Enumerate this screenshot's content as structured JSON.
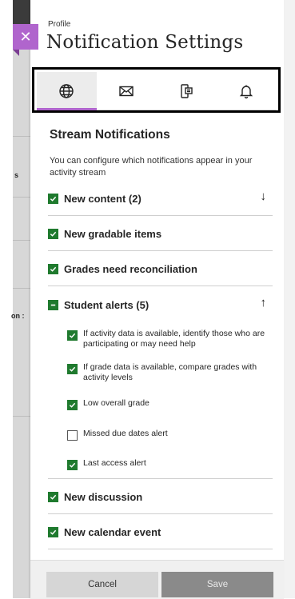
{
  "background_page": {
    "fragments": [
      "s",
      "on :"
    ]
  },
  "header": {
    "breadcrumb": "Profile",
    "title": "Notification Settings",
    "close_icon": "close-icon"
  },
  "tabs": [
    {
      "icon": "globe-icon",
      "active": true
    },
    {
      "icon": "envelope-icon",
      "active": false
    },
    {
      "icon": "mobile-push-icon",
      "active": false
    },
    {
      "icon": "bell-icon",
      "active": false
    }
  ],
  "section": {
    "title": "Stream Notifications",
    "description": "You can configure which notifications appear in your activity stream"
  },
  "options": [
    {
      "label": "New content (2)",
      "state": "checked",
      "expandable": true,
      "expanded": false
    },
    {
      "label": "New gradable items",
      "state": "checked"
    },
    {
      "label": "Grades need reconciliation",
      "state": "checked"
    },
    {
      "label": "Student alerts (5)",
      "state": "indeterminate",
      "expandable": true,
      "expanded": true
    }
  ],
  "student_alerts": [
    {
      "label": "If activity data is available, identify those who are participating or may need help",
      "checked": true
    },
    {
      "label": "If grade data is available, compare grades with activity levels",
      "checked": true
    },
    {
      "label": "Low overall grade",
      "checked": true
    },
    {
      "label": "Missed due dates alert",
      "checked": false
    },
    {
      "label": "Last access alert",
      "checked": true
    }
  ],
  "more_options": [
    {
      "label": "New discussion",
      "state": "checked"
    },
    {
      "label": "New calendar event",
      "state": "checked"
    }
  ],
  "footer": {
    "cancel_label": "Cancel",
    "save_label": "Save"
  },
  "colors": {
    "accent": "#b065cd",
    "checkbox_checked": "#1f7a2e",
    "save_disabled": "#8a8a8a"
  }
}
